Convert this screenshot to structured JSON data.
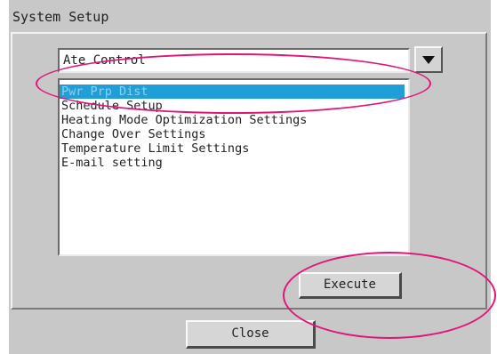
{
  "window": {
    "title": "System Setup"
  },
  "combo": {
    "selected_value": "Ate Control",
    "dropdown_icon": "triangle-down-icon"
  },
  "list": {
    "items": [
      {
        "label": "Pwr Prp Dist",
        "selected": true
      },
      {
        "label": "Schedule Setup",
        "selected": false
      },
      {
        "label": "Heating Mode Optimization Settings",
        "selected": false
      },
      {
        "label": "Change Over Settings",
        "selected": false
      },
      {
        "label": "Temperature Limit Settings",
        "selected": false
      },
      {
        "label": "E-mail setting",
        "selected": false
      }
    ]
  },
  "buttons": {
    "execute_label": "Execute",
    "close_label": "Close"
  },
  "colors": {
    "selection": "#1f9ed8",
    "annotation": "#e0157a",
    "window_bg": "#c8c8c8"
  }
}
